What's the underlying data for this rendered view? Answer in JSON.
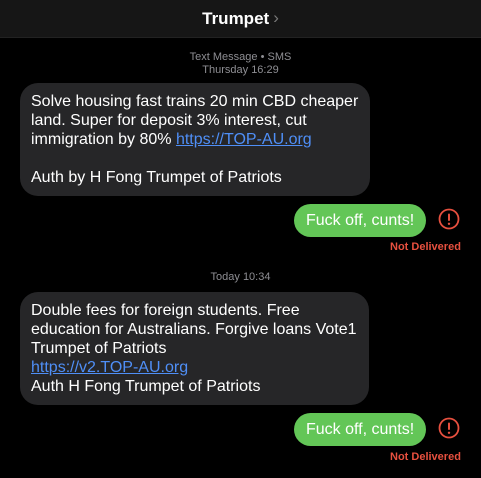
{
  "header": {
    "contact_name": "Trumpet",
    "chevron_icon": "chevron-right-icon"
  },
  "messages": [
    {
      "timestamp_line1": "Text Message • SMS",
      "timestamp_line2": "Thursday 16:29"
    },
    {
      "direction": "incoming",
      "lines": [
        "Solve housing fast trains 20 min CBD cheaper",
        "land. Super for deposit 3% interest, cut"
      ],
      "line3_text": "immigration by 80% ",
      "link": "https://TOP-AU.org",
      "signature": "Auth by H Fong Trumpet of Patriots"
    },
    {
      "direction": "outgoing",
      "text": "Fuck off, cunts!",
      "status": "Not Delivered",
      "status_icon": "exclamation-circle-icon"
    },
    {
      "timestamp": "Today 10:34"
    },
    {
      "direction": "incoming",
      "lines": [
        "Double fees for foreign students. Free",
        "education for Australians. Forgive loans Vote1",
        "Trumpet of Patriots"
      ],
      "link": "https://v2.TOP-AU.org",
      "signature": "Auth H Fong Trumpet of Patriots"
    },
    {
      "direction": "outgoing",
      "text": "Fuck off, cunts!",
      "status": "Not Delivered",
      "status_icon": "exclamation-circle-icon"
    }
  ],
  "colors": {
    "background": "#000000",
    "incoming_bubble": "#262628",
    "outgoing_bubble": "#63c657",
    "link": "#4f8ff7",
    "error": "#e7503f",
    "timestamp": "#8e8e93"
  }
}
